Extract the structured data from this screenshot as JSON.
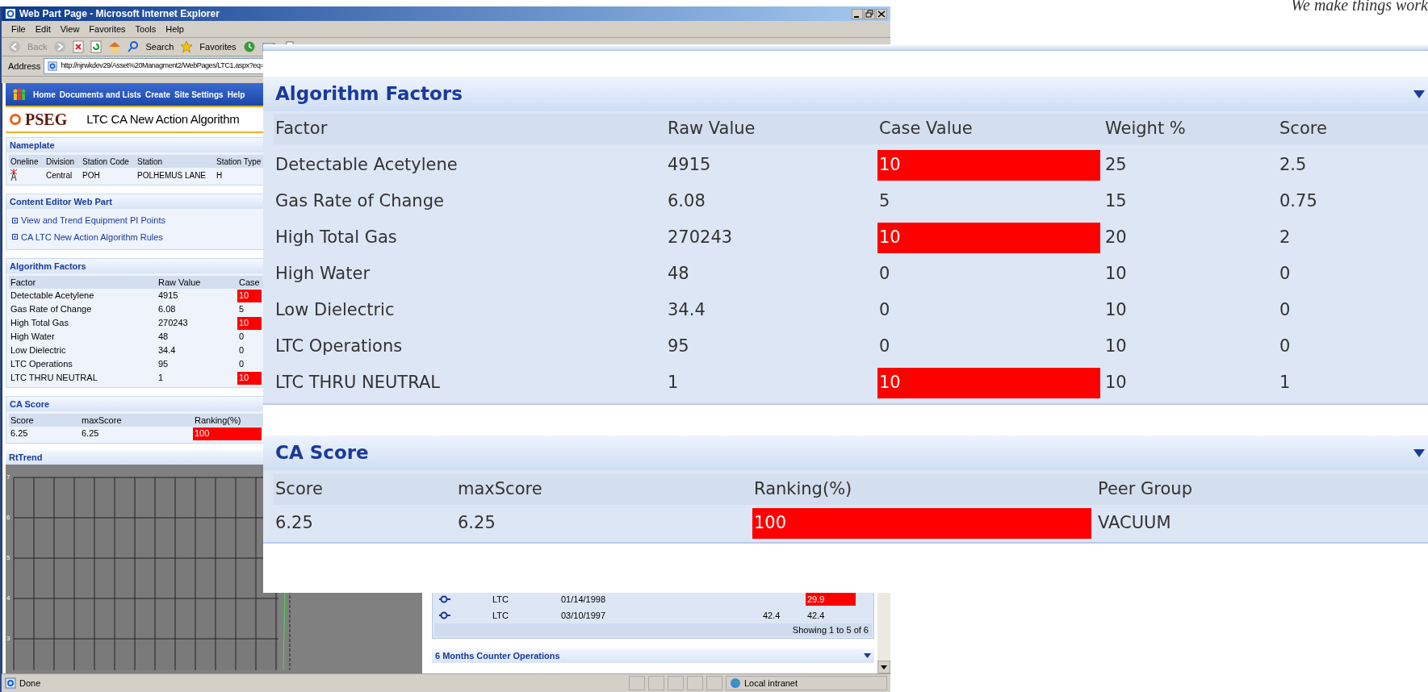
{
  "tagline": "We make things work",
  "browser": {
    "title": "Web Part Page - Microsoft Internet Explorer",
    "menu": [
      "File",
      "Edit",
      "View",
      "Favorites",
      "Tools",
      "Help"
    ],
    "toolbar": {
      "back": "Back",
      "search": "Search",
      "favorites": "Favorites"
    },
    "address_label": "Address",
    "url": "http://njrwkdev29/Asset%20Managment2/WebPages/LTC1.aspx?eq=",
    "nav": [
      "Home",
      "Documents and Lists",
      "Create",
      "Site Settings",
      "Help"
    ],
    "site_logo": "PSEG",
    "page_title": "LTC CA New Action Algorithm",
    "nameplate": {
      "title": "Nameplate",
      "columns": [
        "Oneline",
        "Division",
        "Station Code",
        "Station",
        "Station Type"
      ],
      "row": [
        "Central",
        "POH",
        "POLHEMUS LANE",
        "H"
      ]
    },
    "content_editor": {
      "title": "Content Editor Web Part",
      "links": [
        "View and Trend Equipment PI Points",
        "CA LTC New Action Algorithm Rules"
      ]
    },
    "algorithm_factors": {
      "title": "Algorithm Factors",
      "columns": [
        "Factor",
        "Raw Value",
        "Case"
      ],
      "rows": [
        {
          "factor": "Detectable Acetylene",
          "raw_value": "4915",
          "case_value": "10",
          "highlighted": true
        },
        {
          "factor": "Gas Rate of Change",
          "raw_value": "6.08",
          "case_value": "5",
          "highlighted": false
        },
        {
          "factor": "High Total Gas",
          "raw_value": "270243",
          "case_value": "10",
          "highlighted": true
        },
        {
          "factor": "High Water",
          "raw_value": "48",
          "case_value": "0",
          "highlighted": false
        },
        {
          "factor": "Low Dielectric",
          "raw_value": "34.4",
          "case_value": "0",
          "highlighted": false
        },
        {
          "factor": "LTC Operations",
          "raw_value": "95",
          "case_value": "0",
          "highlighted": false
        },
        {
          "factor": "LTC THRU NEUTRAL",
          "raw_value": "1",
          "case_value": "10",
          "highlighted": true
        }
      ]
    },
    "ca_score": {
      "title": "CA Score",
      "columns": [
        "Score",
        "maxScore",
        "Ranking(%)"
      ],
      "row": {
        "score": "6.25",
        "max_score": "6.25",
        "ranking": "100",
        "highlighted": true
      }
    },
    "rttrend": {
      "title": "RtTrend",
      "y_ticks": [
        "7",
        "6",
        "5",
        "4",
        "3"
      ]
    },
    "readings": {
      "rows": [
        {
          "type": "LTC",
          "date": "01/14/1998",
          "value_2": "29.9",
          "highlighted": true
        },
        {
          "type": "LTC",
          "date": "03/10/1997",
          "value_1": "42.4",
          "value_2": "42.4",
          "highlighted": false
        }
      ],
      "footer": "Showing 1 to 5 of 6"
    },
    "counter_operations": {
      "title": "6 Months Counter Operations"
    },
    "status": {
      "text": "Done",
      "zone": "Local intranet"
    }
  },
  "magnified": {
    "algorithm_factors": {
      "title": "Algorithm Factors",
      "columns": [
        "Factor",
        "Raw Value",
        "Case Value",
        "Weight %",
        "Score"
      ],
      "rows": [
        {
          "factor": "Detectable Acetylene",
          "raw_value": "4915",
          "case_value": "10",
          "weight": "25",
          "score": "2.5",
          "highlighted": true
        },
        {
          "factor": "Gas Rate of Change",
          "raw_value": "6.08",
          "case_value": "5",
          "weight": "15",
          "score": "0.75",
          "highlighted": false
        },
        {
          "factor": "High Total Gas",
          "raw_value": "270243",
          "case_value": "10",
          "weight": "20",
          "score": "2",
          "highlighted": true
        },
        {
          "factor": "High Water",
          "raw_value": "48",
          "case_value": "0",
          "weight": "10",
          "score": "0",
          "highlighted": false
        },
        {
          "factor": "Low Dielectric",
          "raw_value": "34.4",
          "case_value": "0",
          "weight": "10",
          "score": "0",
          "highlighted": false
        },
        {
          "factor": "LTC Operations",
          "raw_value": "95",
          "case_value": "0",
          "weight": "10",
          "score": "0",
          "highlighted": false
        },
        {
          "factor": "LTC THRU NEUTRAL",
          "raw_value": "1",
          "case_value": "10",
          "weight": "10",
          "score": "1",
          "highlighted": true
        }
      ]
    },
    "ca_score": {
      "title": "CA Score",
      "columns": [
        "Score",
        "maxScore",
        "Ranking(%)",
        "Peer Group"
      ],
      "row": {
        "score": "6.25",
        "max_score": "6.25",
        "ranking": "100",
        "peer_group": "VACUUM",
        "highlighted": true
      }
    }
  }
}
